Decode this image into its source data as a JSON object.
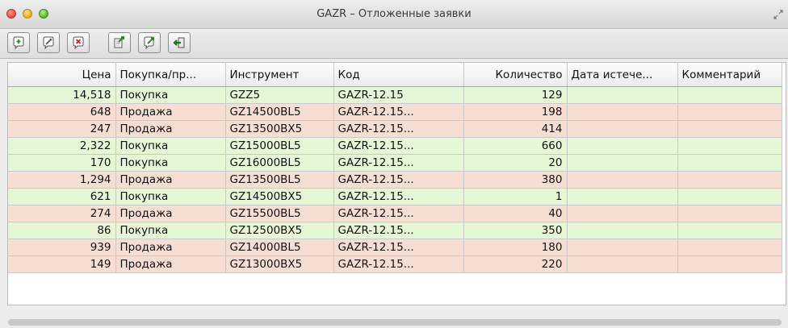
{
  "window": {
    "title": "GAZR – Отложенные заявки"
  },
  "toolbar": {
    "buttons": [
      {
        "name": "add-order-icon",
        "color": "#2a9a2a"
      },
      {
        "name": "edit-order-icon",
        "color": "#555555"
      },
      {
        "name": "delete-order-icon",
        "color": "#cc2222"
      },
      {
        "name": "export-icon",
        "color": "#2a8a2a"
      },
      {
        "name": "send-order-icon",
        "color": "#2a8a2a"
      },
      {
        "name": "exit-icon",
        "color": "#2a8a2a"
      }
    ]
  },
  "table": {
    "headers": [
      "Цена",
      "Покупка/пр...",
      "Инструмент",
      "Код",
      "Количество",
      "Дата истече...",
      "Комментарий"
    ],
    "rows": [
      {
        "price": "14,518",
        "side": "Покупка",
        "instrument": "GZZ5",
        "code": "GAZR-12.15",
        "qty": "129",
        "date": "",
        "comment": "",
        "type": "buy"
      },
      {
        "price": "648",
        "side": "Продажа",
        "instrument": "GZ14500BL5",
        "code": "GAZR-12.15...",
        "qty": "198",
        "date": "",
        "comment": "",
        "type": "sell"
      },
      {
        "price": "247",
        "side": "Продажа",
        "instrument": "GZ13500BX5",
        "code": "GAZR-12.15...",
        "qty": "414",
        "date": "",
        "comment": "",
        "type": "sell"
      },
      {
        "price": "2,322",
        "side": "Покупка",
        "instrument": "GZ15000BL5",
        "code": "GAZR-12.15...",
        "qty": "660",
        "date": "",
        "comment": "",
        "type": "buy"
      },
      {
        "price": "170",
        "side": "Покупка",
        "instrument": "GZ16000BL5",
        "code": "GAZR-12.15...",
        "qty": "20",
        "date": "",
        "comment": "",
        "type": "buy"
      },
      {
        "price": "1,294",
        "side": "Продажа",
        "instrument": "GZ13500BL5",
        "code": "GAZR-12.15...",
        "qty": "380",
        "date": "",
        "comment": "",
        "type": "sell"
      },
      {
        "price": "621",
        "side": "Покупка",
        "instrument": "GZ14500BX5",
        "code": "GAZR-12.15...",
        "qty": "1",
        "date": "",
        "comment": "",
        "type": "buy"
      },
      {
        "price": "274",
        "side": "Продажа",
        "instrument": "GZ15500BL5",
        "code": "GAZR-12.15...",
        "qty": "40",
        "date": "",
        "comment": "",
        "type": "sell"
      },
      {
        "price": "86",
        "side": "Покупка",
        "instrument": "GZ12500BX5",
        "code": "GAZR-12.15...",
        "qty": "350",
        "date": "",
        "comment": "",
        "type": "buy"
      },
      {
        "price": "939",
        "side": "Продажа",
        "instrument": "GZ14000BL5",
        "code": "GAZR-12.15...",
        "qty": "180",
        "date": "",
        "comment": "",
        "type": "sell"
      },
      {
        "price": "149",
        "side": "Продажа",
        "instrument": "GZ13000BX5",
        "code": "GAZR-12.15...",
        "qty": "220",
        "date": "",
        "comment": "",
        "type": "sell"
      }
    ]
  },
  "colors": {
    "buy_row": "#e6f7d8",
    "sell_row": "#f7ded3"
  }
}
